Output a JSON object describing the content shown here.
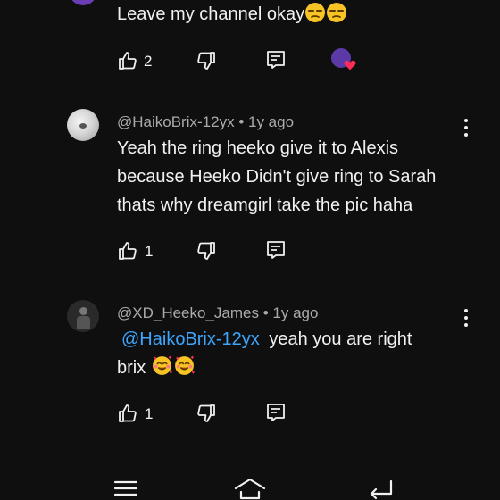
{
  "comments": [
    {
      "text": "Leave my channel okay",
      "likes": "2"
    },
    {
      "author": "@HaikoBrix-12yx",
      "time": "1y ago",
      "lines": [
        "Yeah the ring heeko give it to Alexis",
        "because Heeko Didn't give ring to Sarah",
        "thats why dreamgirl take the pic haha"
      ],
      "likes": "1"
    },
    {
      "author": "@XD_Heeko_James",
      "time": "1y ago",
      "mention": "@HaikoBrix-12yx",
      "line1_rest": "yeah you are right",
      "line2": "brix",
      "likes": "1"
    }
  ],
  "separator": "•",
  "icons": [
    "like-icon",
    "dislike-icon",
    "reply-icon",
    "more-vert-icon",
    "menu-icon",
    "home-icon",
    "back-icon"
  ],
  "colors": {
    "background": "#0f0f0f",
    "text": "#f1f1f1",
    "meta": "#aaaaaa",
    "link": "#3ea6ff"
  }
}
